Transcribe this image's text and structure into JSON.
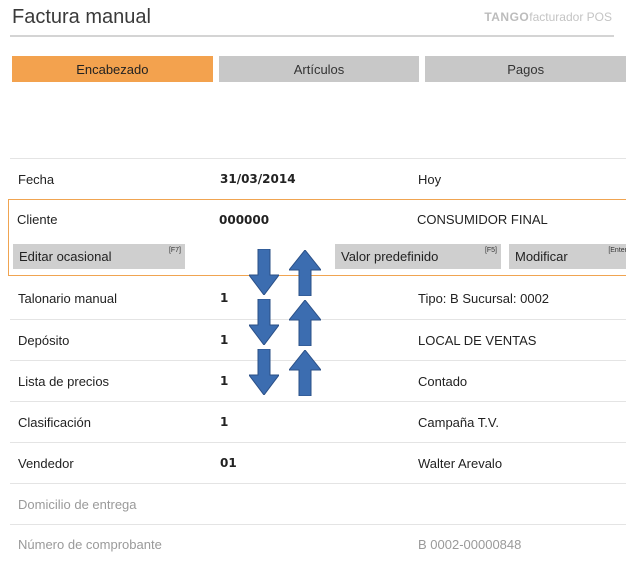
{
  "header": {
    "title": "Factura manual",
    "brand_bold": "TANGO",
    "brand_rest": "facturador POS"
  },
  "tabs": [
    {
      "label": "Encabezado",
      "active": true
    },
    {
      "label": "Artículos",
      "active": false
    },
    {
      "label": "Pagos",
      "active": false
    }
  ],
  "form": {
    "fecha": {
      "label": "Fecha",
      "value": "31/03/2014",
      "extra": "Hoy"
    },
    "cliente": {
      "label": "Cliente",
      "value": "000000",
      "extra": "CONSUMIDOR FINAL"
    },
    "client_buttons": {
      "editar": {
        "label": "Editar ocasional",
        "key": "[F7]"
      },
      "valor": {
        "label": "Valor predefinido",
        "key": "[F5]"
      },
      "modificar": {
        "label": "Modificar",
        "key": "[Enter"
      }
    },
    "talonario": {
      "label": "Talonario manual",
      "value": "1",
      "extra": "Tipo: B  Sucursal: 0002"
    },
    "deposito": {
      "label": "Depósito",
      "value": "1",
      "extra": "LOCAL DE VENTAS"
    },
    "lista": {
      "label": "Lista de precios",
      "value": "1",
      "extra": "Contado"
    },
    "clasificacion": {
      "label": "Clasificación",
      "value": "1",
      "extra": "Campaña T.V."
    },
    "vendedor": {
      "label": "Vendedor",
      "value": "01",
      "extra": "Walter Arevalo"
    },
    "domicilio": {
      "label": "Domicilio de entrega"
    },
    "comprobante": {
      "label": "Número de comprobante",
      "extra": "B 0002-00000848"
    }
  },
  "colors": {
    "accent": "#f3a24e",
    "arrow": "#3c6db0",
    "tab_inactive": "#c8c8c8"
  },
  "icons": {
    "down": "arrow-down-icon",
    "up": "arrow-up-icon"
  }
}
